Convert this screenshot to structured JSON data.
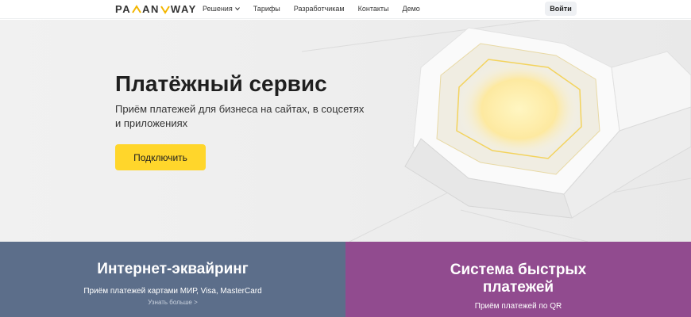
{
  "header": {
    "logo_left": "PA",
    "logo_mid": "AN",
    "logo_right": "WAY",
    "nav": [
      {
        "label": "Решения"
      },
      {
        "label": "Тарифы"
      },
      {
        "label": "Разработчикам"
      },
      {
        "label": "Контакты"
      },
      {
        "label": "Демо"
      }
    ],
    "login_label": "Войти"
  },
  "hero": {
    "title": "Платёжный сервис",
    "subtitle": "Приём платежей для бизнеса на сайтах, в соцсетях и приложениях",
    "cta_label": "Подключить"
  },
  "cards": [
    {
      "title": "Интернет-эквайринг",
      "text": "Приём платежей картами МИР, Visa, MasterCard",
      "link": "Узнать больше >"
    },
    {
      "title": "Система быстрых платежей",
      "text": "Приём платежей по QR"
    }
  ],
  "colors": {
    "accent": "#ffd62b",
    "card_blue": "#5c6e8a",
    "card_purple": "#914b8f"
  }
}
